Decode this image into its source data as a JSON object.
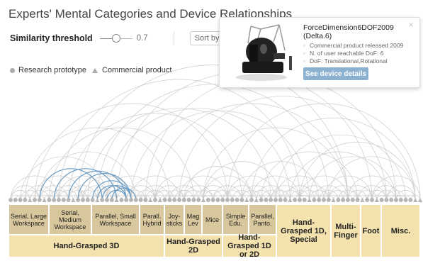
{
  "title": "Experts' Mental Categories and Device Relationships",
  "controls": {
    "threshold_label": "Similarity threshold",
    "threshold_value": "0.7",
    "threshold_fraction": 0.5,
    "sort_label": "Sort by group"
  },
  "legend": {
    "research": "Research prototype",
    "commercial": "Commercial product"
  },
  "popup": {
    "close": "×",
    "device_name": "ForceDimension6DOF2009 (Delta.6)",
    "facts": [
      "Commercial product released 2009",
      "N. of user reachable DoF: 6",
      "DoF: Translational,Rotational"
    ],
    "button_label": "See device details"
  },
  "subcategories": [
    "Serial, Large Workspace",
    "Serial, Medium Workspace",
    "Parallel, Small Workspace",
    "Parall. Hybrid",
    "Joy-sticks",
    "Mag Lev",
    "Mice",
    "Simple Edu.",
    "Parallel, Panto."
  ],
  "groups": [
    "Hand-Grasped 3D",
    "Hand-Grasped 2D",
    "Hand-Grasped 1D or 2D",
    "Hand-Grasped 1D, Special",
    "Multi-Finger",
    "Foot",
    "Misc."
  ],
  "colors": {
    "subcategory": "#d8c79c",
    "group": "#f3e2ad",
    "arc_gray": "#cccccc",
    "arc_highlight": "#6a9cc4",
    "node": "#b5b5b5",
    "button": "#8bb0d0"
  }
}
